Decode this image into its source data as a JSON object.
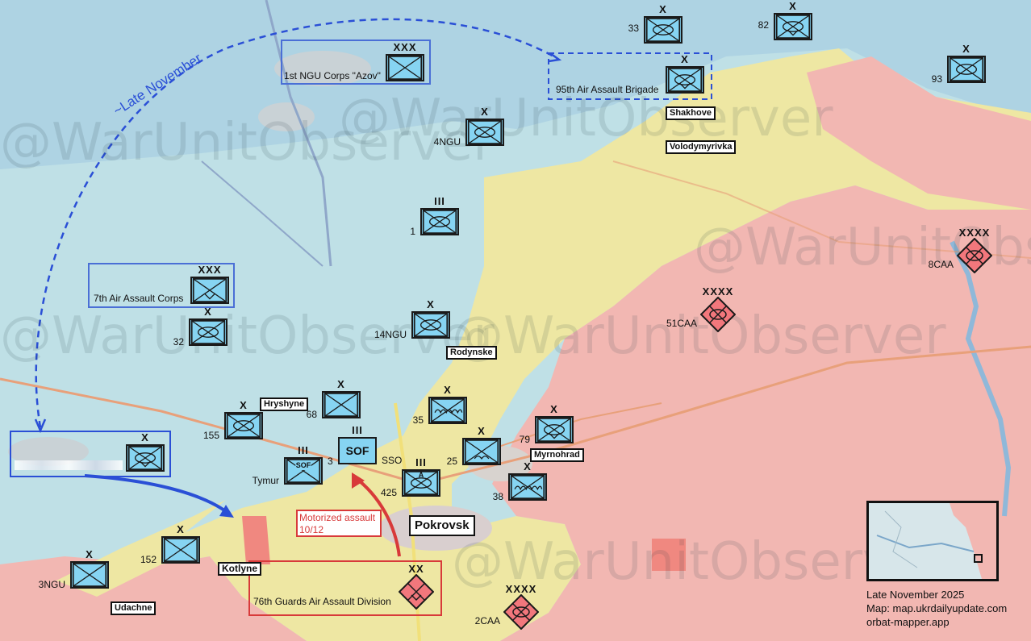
{
  "map": {
    "colors": {
      "ukraine_controlled": "#bfe0e6",
      "russian_controlled": "#f2b7b2",
      "contested": "#eee7a3",
      "friendly_unit_fill": "#86d4f2",
      "enemy_unit_fill": "#f2777c",
      "arrow_blue": "#2a4fd6",
      "arrow_red": "#d83a3a"
    },
    "watermark_text": "@WarUnitObserver",
    "arrow_label": "~Late November",
    "towns": {
      "shakhove": "Shakhove",
      "volodymyrivka": "Volodymyrivka",
      "rodynske": "Rodynske",
      "hryshyne": "Hryshyne",
      "myrnohrad": "Myrnohrad",
      "pokrovsk": "Pokrovsk",
      "kotlyne": "Kotlyne",
      "udachne": "Udachne"
    },
    "formations": {
      "azov": {
        "label": "1st NGU Corps \"Azov\"",
        "echelon": "XXX"
      },
      "air_assault_95": {
        "label": "95th Air Assault Brigade",
        "echelon": "X"
      },
      "air_assault_7": {
        "label": "7th Air Assault Corps",
        "echelon": "XXX"
      },
      "guards_76": {
        "label": "76th Guards Air Assault Division",
        "echelon": "XX"
      }
    },
    "units": {
      "u33": {
        "label": "33",
        "echelon": "X"
      },
      "u82": {
        "label": "82",
        "echelon": "X"
      },
      "u93": {
        "label": "93",
        "echelon": "X"
      },
      "u4ngu": {
        "label": "4NGU",
        "echelon": "X"
      },
      "u1": {
        "label": "1",
        "echelon": "III"
      },
      "u32": {
        "label": "32",
        "echelon": "X"
      },
      "u14ngu": {
        "label": "14NGU",
        "echelon": "X"
      },
      "u155": {
        "label": "155",
        "echelon": "X"
      },
      "u68": {
        "label": "68",
        "echelon": "X"
      },
      "u35": {
        "label": "35",
        "echelon": "X"
      },
      "u79": {
        "label": "79",
        "echelon": "X"
      },
      "u25": {
        "label": "25",
        "echelon": "X"
      },
      "u38": {
        "label": "38",
        "echelon": "X"
      },
      "u425": {
        "label": "425",
        "echelon": "III",
        "symbol": "A"
      },
      "usso": {
        "label": "SSO",
        "echelon": "III",
        "symbol": "SOF"
      },
      "u3": {
        "label": "3",
        "echelon": "III",
        "symbol": "SOF"
      },
      "utymur": {
        "label": "Tymur"
      },
      "u152": {
        "label": "152",
        "echelon": "X"
      },
      "u3ngu": {
        "label": "3NGU",
        "echelon": "X"
      },
      "uwest": {
        "echelon": "X"
      }
    },
    "enemy": {
      "e8caa": {
        "label": "8CAA",
        "echelon": "XXXX"
      },
      "e51caa": {
        "label": "51CAA",
        "echelon": "XXXX"
      },
      "e2caa": {
        "label": "2CAA",
        "echelon": "XXXX"
      }
    },
    "motorized_assault": {
      "line1": "Motorized assault",
      "line2": "10/12"
    },
    "info": {
      "date": "Late November 2025",
      "map_source": "Map: map.ukrdailyupdate.com",
      "credit": "orbat-mapper.app"
    }
  }
}
